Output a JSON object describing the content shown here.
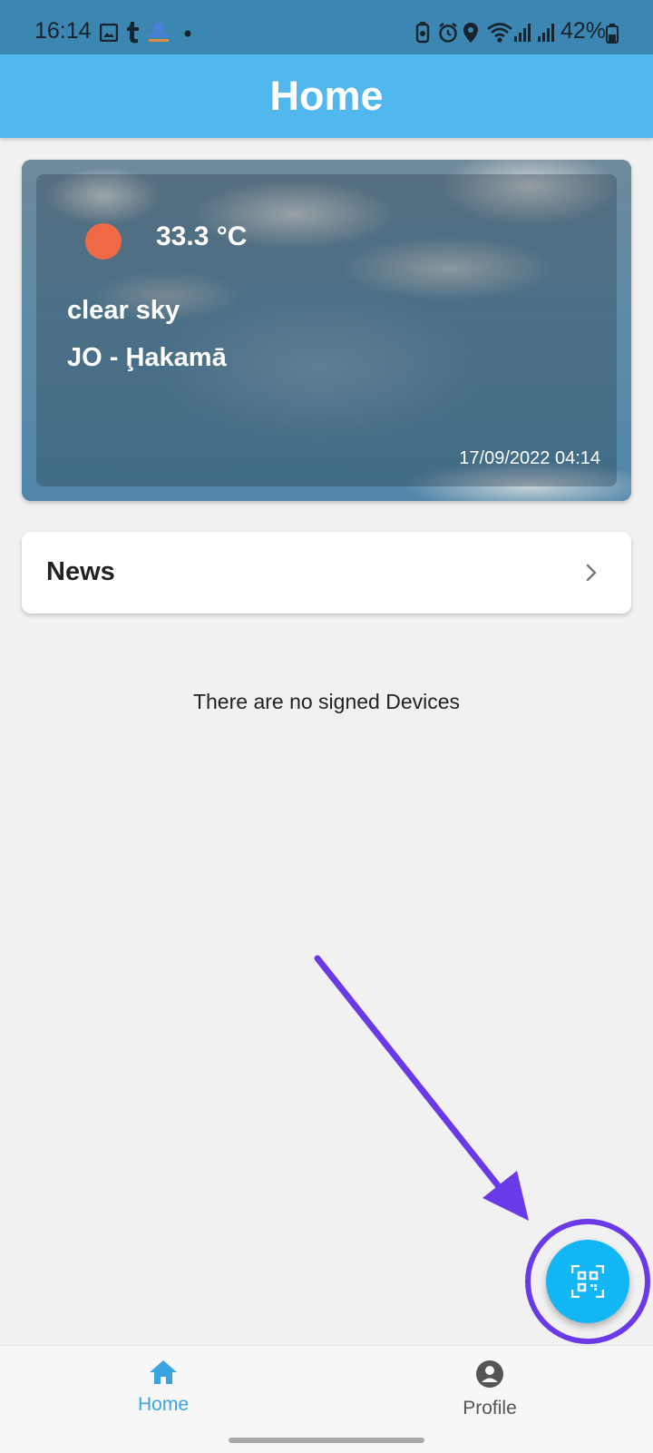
{
  "status_bar": {
    "time": "16:14",
    "battery_percent": "42%",
    "left_icons": [
      "gallery-icon",
      "tumblr-icon",
      "app-icon",
      "dot-icon"
    ],
    "right_icons": [
      "battery-saver-icon",
      "alarm-icon",
      "location-icon",
      "wifi-icon",
      "signal-icon",
      "signal-icon",
      "battery-icon"
    ]
  },
  "app_bar": {
    "title": "Home"
  },
  "weather": {
    "temperature": "33.3 °C",
    "description": "clear sky",
    "location": "JO - Ḩakamā",
    "datetime": "17/09/2022 04:14",
    "icon": "sun-icon",
    "icon_color": "#ef6a45"
  },
  "news": {
    "label": "News"
  },
  "devices": {
    "empty_message": "There are no signed Devices"
  },
  "fab": {
    "icon": "qr-scan-icon",
    "color": "#12b6f5"
  },
  "bottom_nav": {
    "items": [
      {
        "label": "Home",
        "icon": "home-icon",
        "active": true
      },
      {
        "label": "Profile",
        "icon": "profile-icon",
        "active": false
      }
    ]
  },
  "colors": {
    "app_bar": "#51b8ee",
    "status_bar": "#3c87b2",
    "active_nav": "#3aa4e0",
    "annotation": "#6a39e8"
  }
}
